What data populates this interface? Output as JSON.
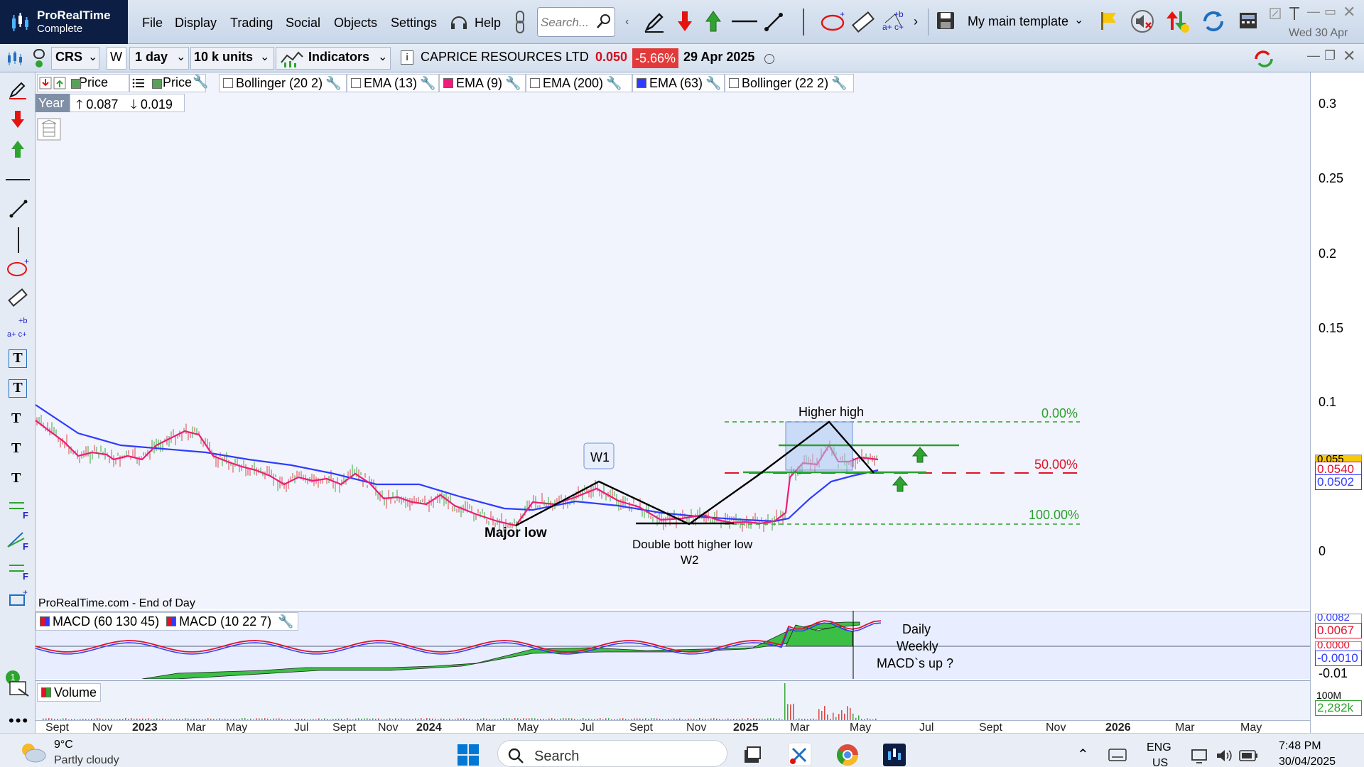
{
  "app": {
    "name": "ProRealTime",
    "edition": "Complete"
  },
  "menu": [
    "File",
    "Display",
    "Trading",
    "Social",
    "Objects",
    "Settings"
  ],
  "help_label": "Help",
  "search_placeholder": "Search...",
  "template_label": "My main template",
  "clock_date": "Wed 30 Apr",
  "controls": {
    "ticker": "CRS",
    "w_label": "W",
    "timeframe": "1 day",
    "units": "10 k units",
    "indicators_label": "Indicators",
    "instrument_name": "CAPRICE RESOURCES LTD",
    "last_price": "0.050",
    "change_pct": "-5.66%",
    "quote_date": "29 Apr 2025"
  },
  "legend": {
    "items": [
      {
        "label": "Price",
        "color": "#5aa05a"
      },
      {
        "label": "Price",
        "color": "#5aa05a"
      },
      {
        "label": "Bollinger (20 2)",
        "color": "#ffffff"
      },
      {
        "label": "EMA (13)",
        "color": "#ffffff"
      },
      {
        "label": "EMA (9)",
        "color": "#ee1c7a"
      },
      {
        "label": "EMA (200)",
        "color": "#ffffff"
      },
      {
        "label": "EMA (63)",
        "color": "#2f3cff"
      },
      {
        "label": "Bollinger (22 2)",
        "color": "#ffffff"
      }
    ],
    "year_label": "Year",
    "year_high": "0.087",
    "year_low": "0.019"
  },
  "annotations": {
    "w1": "W1",
    "major_low": "Major low",
    "double_bottom_1": "Double bott higher low",
    "double_bottom_2": "W2",
    "higher_high": "Higher high",
    "fib_0": "0.00%",
    "fib_50": "50.00%",
    "fib_100": "100.00%",
    "macd_note_1": "Daily",
    "macd_note_2": "Weekly",
    "macd_note_3": "MACD`s up  ?",
    "source": "ProRealTime.com - End of Day"
  },
  "price_axis": {
    "ticks": [
      "0.3",
      "0.25",
      "0.2",
      "0.15",
      "0.1",
      "0"
    ],
    "tags": [
      "0.055",
      "0.0540",
      "0.0502"
    ]
  },
  "macd": {
    "legend_1": "MACD (60 130 45)",
    "legend_2": "MACD (10 22 7)",
    "axis_tags": [
      "0.0082",
      "0.0067",
      "0.0000",
      "-0.0010"
    ],
    "axis_tick": "-0.01"
  },
  "volume": {
    "legend": "Volume",
    "axis_tags": [
      "100M",
      "2,282k"
    ]
  },
  "x_axis": [
    "Sept",
    "Nov",
    "2023",
    "Mar",
    "May",
    "Jul",
    "Sept",
    "Nov",
    "2024",
    "Mar",
    "May",
    "Jul",
    "Sept",
    "Nov",
    "2025",
    "Mar",
    "May",
    "Jul",
    "Sept",
    "Nov",
    "2026",
    "Mar",
    "May"
  ],
  "taskbar": {
    "weather_temp": "9°C",
    "weather_desc": "Partly cloudy",
    "search_label": "Search",
    "lang_1": "ENG",
    "lang_2": "US",
    "time": "7:48 PM",
    "date": "30/04/2025"
  },
  "colors": {
    "ema9": "#ee1c7a",
    "ema63": "#2f3cff",
    "fib": "#2da02d",
    "fib_mid": "#e2122b",
    "accent_dark": "#0c1e44"
  }
}
